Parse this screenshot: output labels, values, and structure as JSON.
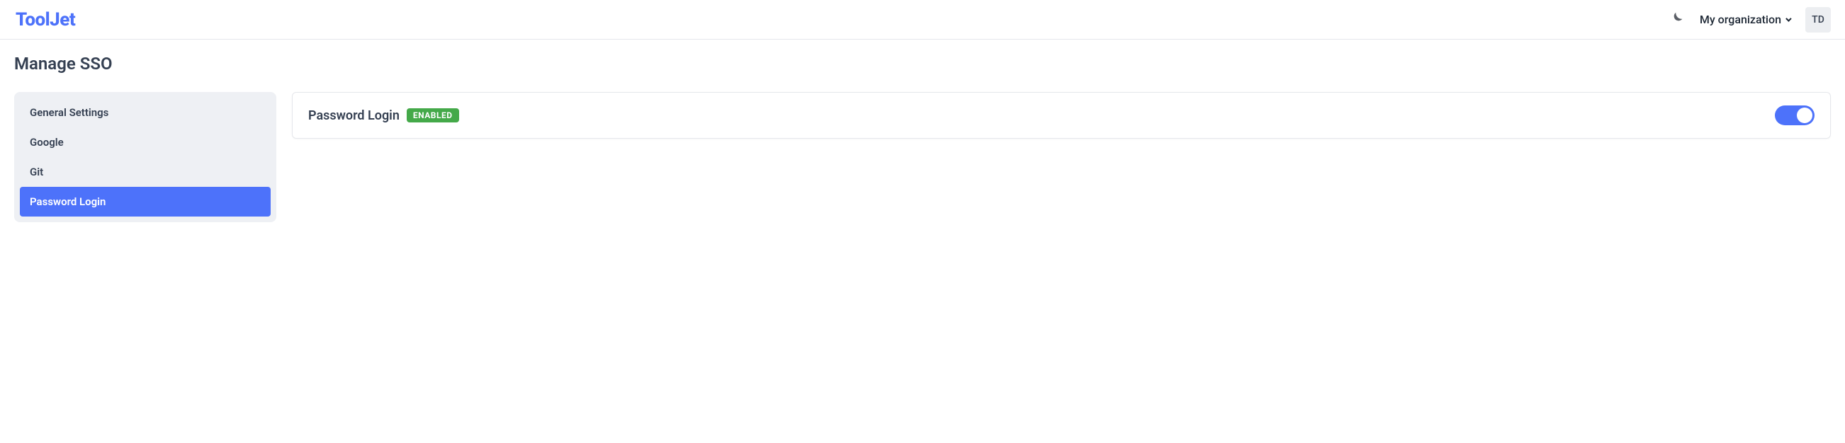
{
  "header": {
    "logo_text": "ToolJet",
    "org_label": "My organization",
    "avatar_initials": "TD"
  },
  "page": {
    "title": "Manage SSO"
  },
  "sidebar": {
    "items": [
      {
        "label": "General Settings",
        "active": false
      },
      {
        "label": "Google",
        "active": false
      },
      {
        "label": "Git",
        "active": false
      },
      {
        "label": "Password Login",
        "active": true
      }
    ]
  },
  "card": {
    "title": "Password Login",
    "badge": "ENABLED",
    "toggle_on": true
  }
}
